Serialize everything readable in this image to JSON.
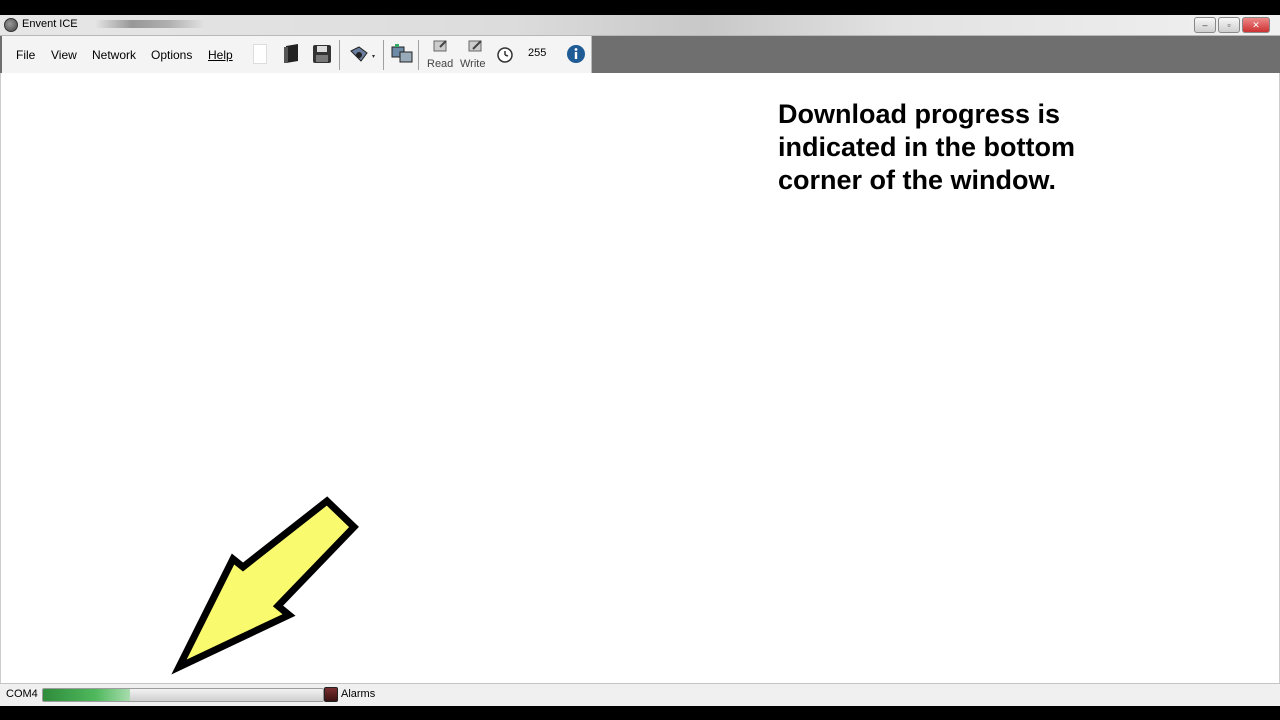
{
  "window": {
    "title": "Envent ICE",
    "controls": {
      "minimize": "–",
      "maximize": "▫",
      "close": "✕"
    }
  },
  "menu": {
    "items": [
      {
        "label": "File"
      },
      {
        "label": "View"
      },
      {
        "label": "Network"
      },
      {
        "label": "Options"
      },
      {
        "label": "Help"
      }
    ]
  },
  "toolbar": {
    "icons": [
      "blank-document-icon",
      "open-book-icon",
      "save-disk-icon",
      "device-scan-icon",
      "network-connect-icon",
      "read-icon",
      "write-icon",
      "clock-icon",
      "info-icon"
    ],
    "read_label": "Read",
    "write_label": "Write",
    "address_value": "255"
  },
  "annotation": {
    "text": "Download progress is indicated in the bottom corner of the window."
  },
  "statusbar": {
    "port": "COM4",
    "progress_fraction": 0.31,
    "progress_color": "#3a9a47",
    "alarms_label": "Alarms"
  },
  "colors": {
    "arrow_fill": "#fafa6e",
    "arrow_stroke": "#000000",
    "info_icon": "#1f5c96"
  }
}
